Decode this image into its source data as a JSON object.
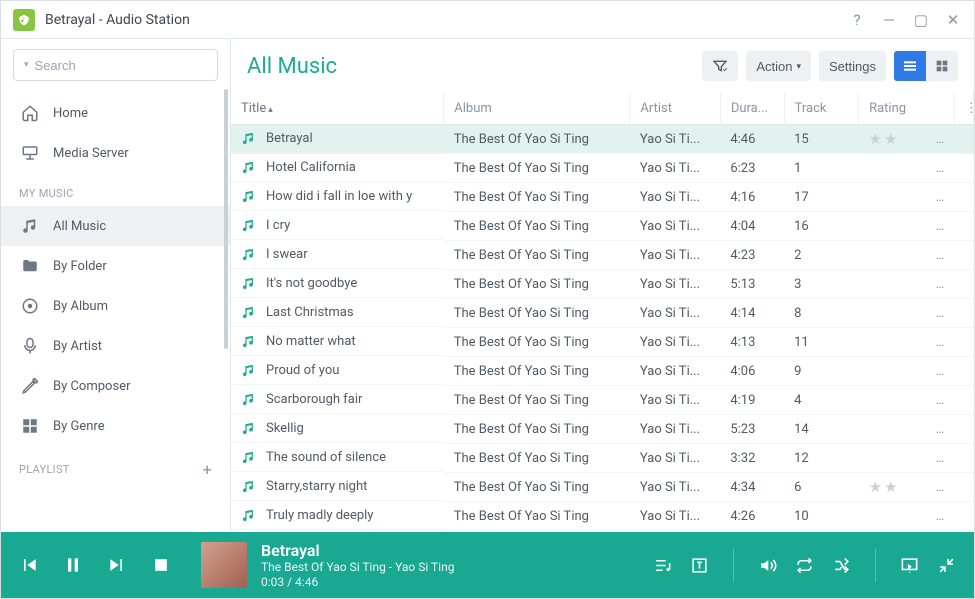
{
  "window": {
    "title": "Betrayal - Audio Station"
  },
  "search": {
    "placeholder": "Search"
  },
  "nav": {
    "home": "Home",
    "media_server": "Media Server",
    "section_my_music": "MY MUSIC",
    "all_music": "All Music",
    "by_folder": "By Folder",
    "by_album": "By Album",
    "by_artist": "By Artist",
    "by_composer": "By Composer",
    "by_genre": "By Genre",
    "section_playlist": "PLAYLIST"
  },
  "toolbar": {
    "page_title": "All Music",
    "action": "Action",
    "settings": "Settings"
  },
  "columns": {
    "title": "Title",
    "album": "Album",
    "artist": "Artist",
    "duration": "Dura...",
    "track": "Track",
    "rating": "Rating"
  },
  "tracks": [
    {
      "title": "Betrayal",
      "album": "The Best Of Yao Si Ting",
      "artist": "Yao Si Ti...",
      "duration": "4:46",
      "track": "15",
      "rated": true,
      "selected": true
    },
    {
      "title": "Hotel California",
      "album": "The Best Of Yao Si Ting",
      "artist": "Yao Si Ti...",
      "duration": "6:23",
      "track": "1"
    },
    {
      "title": "How did i fall in loe with y",
      "album": "The Best Of Yao Si Ting",
      "artist": "Yao Si Ti...",
      "duration": "4:16",
      "track": "17"
    },
    {
      "title": "I cry",
      "album": "The Best Of Yao Si Ting",
      "artist": "Yao Si Ti...",
      "duration": "4:04",
      "track": "16"
    },
    {
      "title": "I swear",
      "album": "The Best Of Yao Si Ting",
      "artist": "Yao Si Ti...",
      "duration": "4:23",
      "track": "2"
    },
    {
      "title": "It's not goodbye",
      "album": "The Best Of Yao Si Ting",
      "artist": "Yao Si Ti...",
      "duration": "5:13",
      "track": "3"
    },
    {
      "title": "Last Christmas",
      "album": "The Best Of Yao Si Ting",
      "artist": "Yao Si Ti...",
      "duration": "4:14",
      "track": "8"
    },
    {
      "title": "No matter what",
      "album": "The Best Of Yao Si Ting",
      "artist": "Yao Si Ti...",
      "duration": "4:13",
      "track": "11"
    },
    {
      "title": "Proud of you",
      "album": "The Best Of Yao Si Ting",
      "artist": "Yao Si Ti...",
      "duration": "4:06",
      "track": "9"
    },
    {
      "title": "Scarborough fair",
      "album": "The Best Of Yao Si Ting",
      "artist": "Yao Si Ti...",
      "duration": "4:19",
      "track": "4"
    },
    {
      "title": "Skellig",
      "album": "The Best Of Yao Si Ting",
      "artist": "Yao Si Ti...",
      "duration": "5:23",
      "track": "14"
    },
    {
      "title": "The sound of silence",
      "album": "The Best Of Yao Si Ting",
      "artist": "Yao Si Ti...",
      "duration": "3:32",
      "track": "12"
    },
    {
      "title": "Starry,starry night",
      "album": "The Best Of Yao Si Ting",
      "artist": "Yao Si Ti...",
      "duration": "4:34",
      "track": "6",
      "rated": true
    },
    {
      "title": "Truly madly deeply",
      "album": "The Best Of Yao Si Ting",
      "artist": "Yao Si Ti...",
      "duration": "4:26",
      "track": "10"
    }
  ],
  "player": {
    "title": "Betrayal",
    "meta": "The Best Of Yao Si Ting - Yao Si Ting",
    "time": "0:03 / 4:46"
  }
}
